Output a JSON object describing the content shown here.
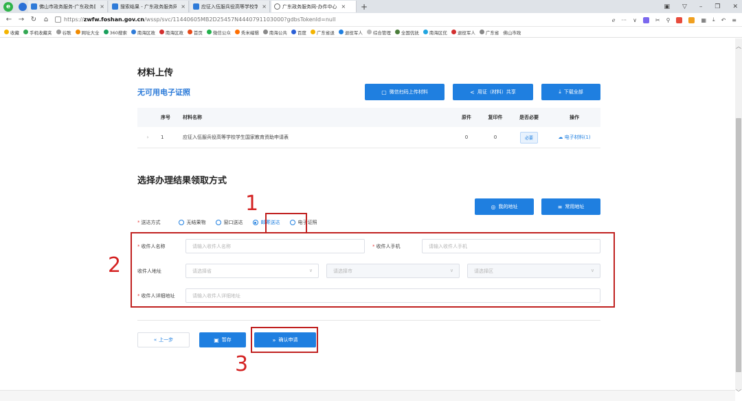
{
  "browser": {
    "logo": "e",
    "tabs": [
      {
        "label": "佛山市政务服务-广东政务服务",
        "active": false
      },
      {
        "label": "搜索结果 - 广东政务服务网",
        "active": false
      },
      {
        "label": "应征入伍服兵役高等学校学生",
        "active": false
      },
      {
        "label": "广东政务服务网-办件中心",
        "active": true
      }
    ],
    "new_tab": "+",
    "url_prefix": "https://",
    "url_host": "zwfw.foshan.gov.cn",
    "url_path": "/wssp/svc/11440605MB2D25457N4440791103000?gdbsTokenId=null",
    "bookmarks": [
      "收藏",
      "手机收藏夹",
      "谷歌",
      "网址大全",
      "360搜索",
      "南海区政",
      "南海区政",
      "首页",
      "微信公众",
      "秀米编辑",
      "南海公共",
      "百度",
      "广东省退",
      "退役军人",
      "综合管理",
      "全国优抚",
      "南海区优",
      "退役军人",
      "广东省",
      "佛山市政"
    ]
  },
  "materials": {
    "title": "材料上传",
    "no_cert": "无可用电子证照",
    "buttons": {
      "wechat_upload": "微信扫码上传材料",
      "share": "用证（材料）共享",
      "download_all": "下载全部"
    },
    "columns": {
      "no": "序号",
      "name": "材料名称",
      "original": "原件",
      "copy": "复印件",
      "required": "是否必要",
      "operation": "操作"
    },
    "rows": [
      {
        "no": "1",
        "name": "应征入伍服兵役高等学校学生国家教育资助申请表",
        "original": "0",
        "copy": "0",
        "required": "必要",
        "operation": "电子材料(1)"
      }
    ]
  },
  "delivery": {
    "title": "选择办理结果领取方式",
    "my_address_button": "我的地址",
    "common_address_button": "常用地址",
    "method_label": "送达方式",
    "options": [
      "无结果物",
      "窗口送达",
      "邮寄送达",
      "电子证照"
    ],
    "selected": "邮寄送达",
    "recipient_name_label": "收件人名称",
    "recipient_name_placeholder": "请输入收件人名称",
    "recipient_phone_label": "收件人手机",
    "recipient_phone_placeholder": "请输入收件人手机",
    "address_label": "收件人地址",
    "province_placeholder": "请选择省",
    "city_placeholder": "请选择市",
    "district_placeholder": "请选择区",
    "detail_label": "收件人详细地址",
    "detail_placeholder": "请输入收件人详细地址"
  },
  "actions": {
    "prev": "上一步",
    "save": "暂存",
    "confirm": "确认申请"
  },
  "annotations": [
    "1",
    "2",
    "3"
  ],
  "colors": {
    "primary": "#1f7fe0",
    "annotation": "#c0201f"
  }
}
